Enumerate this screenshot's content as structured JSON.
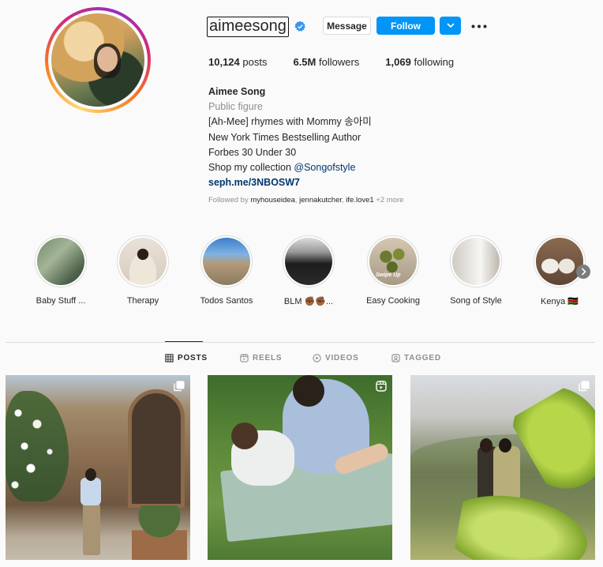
{
  "profile": {
    "username": "aimeesong",
    "actions": {
      "message_label": "Message",
      "follow_label": "Follow"
    },
    "stats": {
      "posts_value": "10,124",
      "posts_label": "posts",
      "followers_value": "6.5M",
      "followers_label": "followers",
      "following_value": "1,069",
      "following_label": "following"
    },
    "bio": {
      "name": "Aimee Song",
      "category": "Public figure",
      "line1": "[Ah-Mee] rhymes with Mommy 송아미",
      "line2": "New York Times Bestselling Author",
      "line3": "Forbes 30 Under 30",
      "line4_prefix": "Shop my collection ",
      "line4_mention": "@Songofstyle",
      "link": "seph.me/3NBOSW7"
    },
    "followed_by": {
      "prefix": "Followed by ",
      "user1": "myhouseidea",
      "user2": "jennakutcher",
      "user3": "ife.love1",
      "more": "+2 more"
    }
  },
  "highlights": [
    {
      "label": "Baby Stuff ..."
    },
    {
      "label": "Therapy"
    },
    {
      "label": "Todos Santos"
    },
    {
      "label": "BLM ✊🏾✊🏾..."
    },
    {
      "label": "Easy Cooking",
      "overlay": "Swipe Up"
    },
    {
      "label": "Song of Style"
    },
    {
      "label": "Kenya 🇰🇪"
    }
  ],
  "tabs": [
    {
      "label": "POSTS",
      "active": true
    },
    {
      "label": "REELS"
    },
    {
      "label": "VIDEOS"
    },
    {
      "label": "TAGGED"
    }
  ],
  "posts": [
    {
      "icon": "carousel-icon"
    },
    {
      "icon": "reel-icon"
    },
    {
      "icon": "carousel-icon"
    }
  ],
  "colors": {
    "accent": "#0095f6",
    "verified": "#3897f0",
    "link": "#00376b",
    "secondary_text": "#8e8e8e"
  }
}
